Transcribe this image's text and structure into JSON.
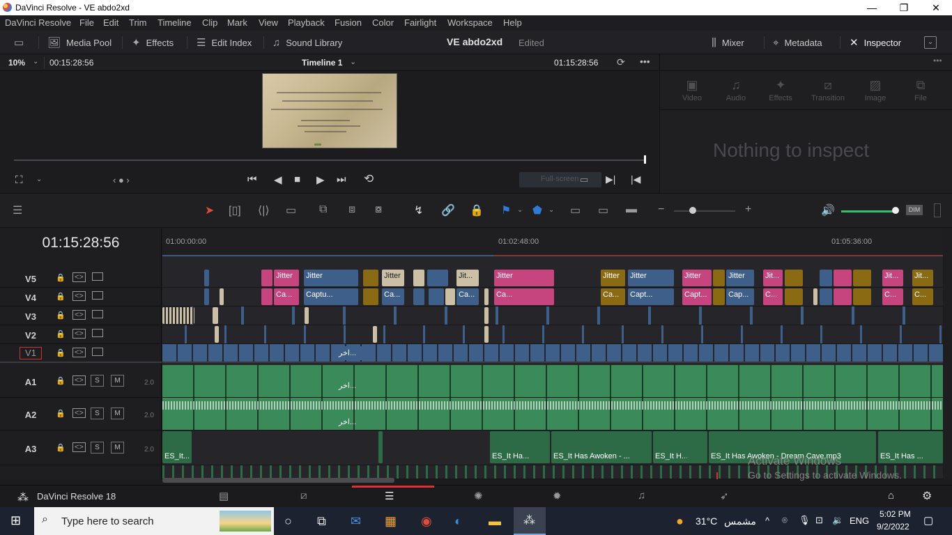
{
  "titlebar": {
    "title": "DaVinci Resolve - VE abdo2xd"
  },
  "menu": {
    "items": [
      "DaVinci Resolve",
      "File",
      "Edit",
      "Trim",
      "Timeline",
      "Clip",
      "Mark",
      "View",
      "Playback",
      "Fusion",
      "Color",
      "Fairlight",
      "Workspace",
      "Help"
    ]
  },
  "toolbar": {
    "media_pool": "Media Pool",
    "effects": "Effects",
    "edit_index": "Edit Index",
    "sound_library": "Sound Library",
    "project": "VE abdo2xd",
    "status": "Edited",
    "mixer": "Mixer",
    "metadata": "Metadata",
    "inspector": "Inspector"
  },
  "viewer": {
    "zoom": "10%",
    "source_tc": "00:15:28:56",
    "timeline_name": "Timeline 1",
    "record_tc": "01:15:28:56",
    "fullscreen_label": "Full-screen"
  },
  "inspector": {
    "tabs": [
      "Video",
      "Audio",
      "Effects",
      "Transition",
      "Image",
      "File"
    ],
    "empty_message": "Nothing to inspect"
  },
  "timeline": {
    "timecode": "01:15:28:56",
    "ruler": [
      "01:00:00:00",
      "01:02:48:00",
      "01:05:36:00"
    ],
    "video_tracks": [
      "V5",
      "V4",
      "V3",
      "V2",
      "V1"
    ],
    "audio_tracks": [
      {
        "name": "A1",
        "level": "2.0"
      },
      {
        "name": "A2",
        "level": "2.0"
      },
      {
        "name": "A3",
        "level": "2.0"
      }
    ],
    "solo": "S",
    "mute": "M",
    "clip_labels": {
      "jitter": "Jitter",
      "jit": "Jit...",
      "capture": "Captu...",
      "capt": "Capt...",
      "cap": "Cap...",
      "ca": "Ca...",
      "c": "C...",
      "arabic": "اخر...",
      "es_it": "ES_It...",
      "es_it_ha": "ES_It Ha...",
      "es_awoken_short": "ES_It Has Awoken - ...",
      "es_it_h": "ES_It H...",
      "es_dream": "ES_It Has Awoken - Dream Cave.mp3",
      "es_it_has": "ES_It Has ..."
    }
  },
  "bottombar": {
    "app_name": "DaVinci Resolve 18"
  },
  "activation": {
    "line1": "Activate Windows",
    "line2": "Go to Settings to activate Windows."
  },
  "taskbar": {
    "search_placeholder": "Type here to search",
    "weather": "31°C",
    "weather_text": "مشمس",
    "language": "ENG",
    "time": "5:02 PM",
    "date": "9/2/2022"
  },
  "colors": {
    "clip_blue": "#3e5f8a",
    "clip_pink": "#c7457f",
    "clip_gold": "#8a6a12",
    "clip_beige": "#cbbfa6",
    "audio_green": "#3b8a5a"
  }
}
